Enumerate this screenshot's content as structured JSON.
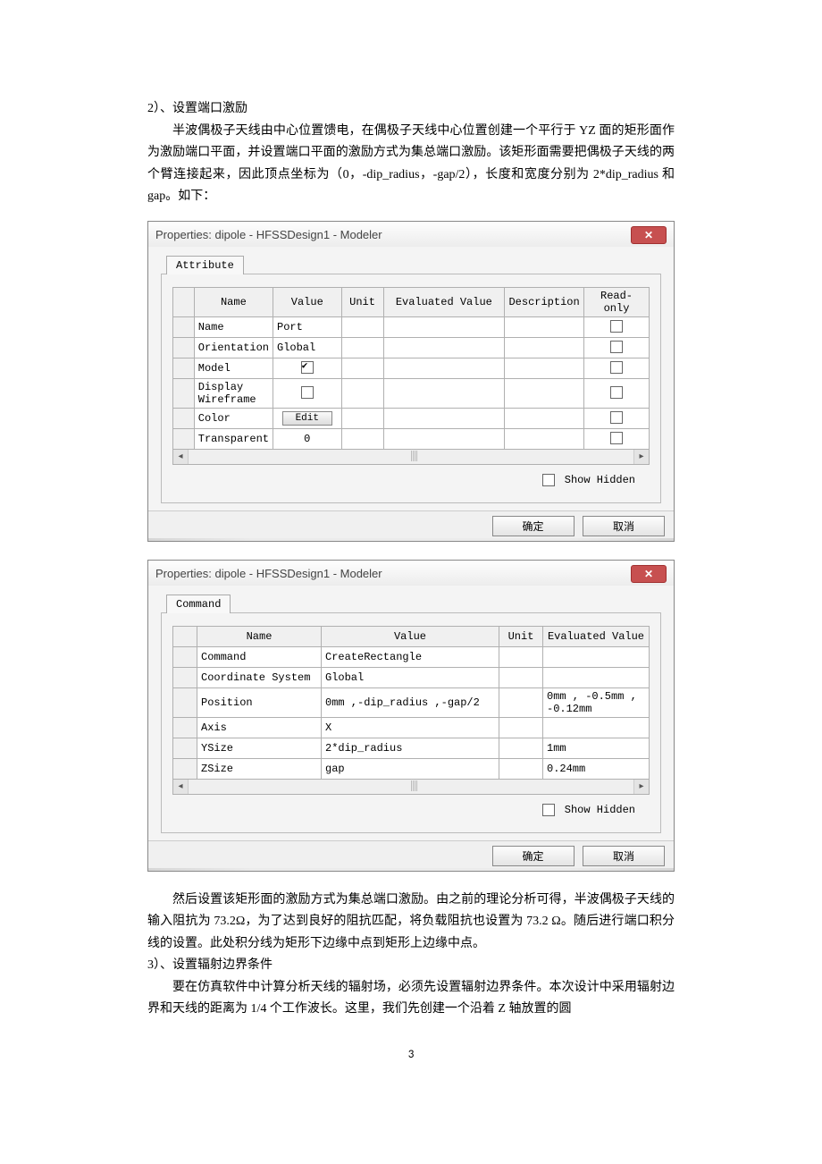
{
  "text": {
    "heading": "2）、设置端口激励",
    "p1": "半波偶极子天线由中心位置馈电，在偶极子天线中心位置创建一个平行于 YZ 面的矩形面作为激励端口平面，并设置端口平面的激励方式为集总端口激励。该矩形面需要把偶极子天线的两个臂连接起来，因此顶点坐标为（0，-dip_radius，-gap/2），长度和宽度分别为 2*dip_radius 和 gap。如下：",
    "p2": "然后设置该矩形面的激励方式为集总端口激励。由之前的理论分析可得，半波偶极子天线的输入阻抗为 73.2Ω，为了达到良好的阻抗匹配，将负载阻抗也设置为 73.2 Ω。随后进行端口积分线的设置。此处积分线为矩形下边缘中点到矩形上边缘中点。",
    "h2": "3）、设置辐射边界条件",
    "p3": "要在仿真软件中计算分析天线的辐射场，必须先设置辐射边界条件。本次设计中采用辐射边界和天线的距离为 1/4 个工作波长。这里，我们先创建一个沿着 Z 轴放置的圆",
    "pageNum": "3"
  },
  "dialog1": {
    "title": "Properties: dipole - HFSSDesign1 - Modeler",
    "tab": "Attribute",
    "headers": [
      "",
      "Name",
      "Value",
      "Unit",
      "Evaluated Value",
      "Description",
      "Read-only"
    ],
    "rows": [
      {
        "name": "Name",
        "value": "Port",
        "unit": "",
        "eval": "",
        "desc": "",
        "ro": false
      },
      {
        "name": "Orientation",
        "value": "Global",
        "unit": "",
        "eval": "",
        "desc": "",
        "ro": false
      },
      {
        "name": "Model",
        "value": "[check-true]",
        "unit": "",
        "eval": "",
        "desc": "",
        "ro": false
      },
      {
        "name": "Display Wireframe",
        "value": "[check-false]",
        "unit": "",
        "eval": "",
        "desc": "",
        "ro": false
      },
      {
        "name": "Color",
        "value": "[edit]",
        "unit": "",
        "eval": "",
        "desc": "",
        "ro": false
      },
      {
        "name": "Transparent",
        "value": "0",
        "unit": "",
        "eval": "",
        "desc": "",
        "ro": false
      }
    ],
    "editLabel": "Edit",
    "showHidden": "Show Hidden",
    "ok": "确定",
    "cancel": "取消"
  },
  "dialog2": {
    "title": "Properties: dipole - HFSSDesign1 - Modeler",
    "tab": "Command",
    "headers": [
      "",
      "Name",
      "Value",
      "Unit",
      "Evaluated Value"
    ],
    "rows": [
      {
        "name": "Command",
        "value": "CreateRectangle",
        "unit": "",
        "eval": ""
      },
      {
        "name": "Coordinate System",
        "value": "Global",
        "unit": "",
        "eval": ""
      },
      {
        "name": "Position",
        "value": "0mm ,-dip_radius ,-gap/2",
        "unit": "",
        "eval": "0mm , -0.5mm , -0.12mm"
      },
      {
        "name": "Axis",
        "value": "X",
        "unit": "",
        "eval": ""
      },
      {
        "name": "YSize",
        "value": "2*dip_radius",
        "unit": "",
        "eval": "1mm"
      },
      {
        "name": "ZSize",
        "value": "gap",
        "unit": "",
        "eval": "0.24mm"
      }
    ],
    "showHidden": "Show Hidden",
    "ok": "确定",
    "cancel": "取消"
  }
}
